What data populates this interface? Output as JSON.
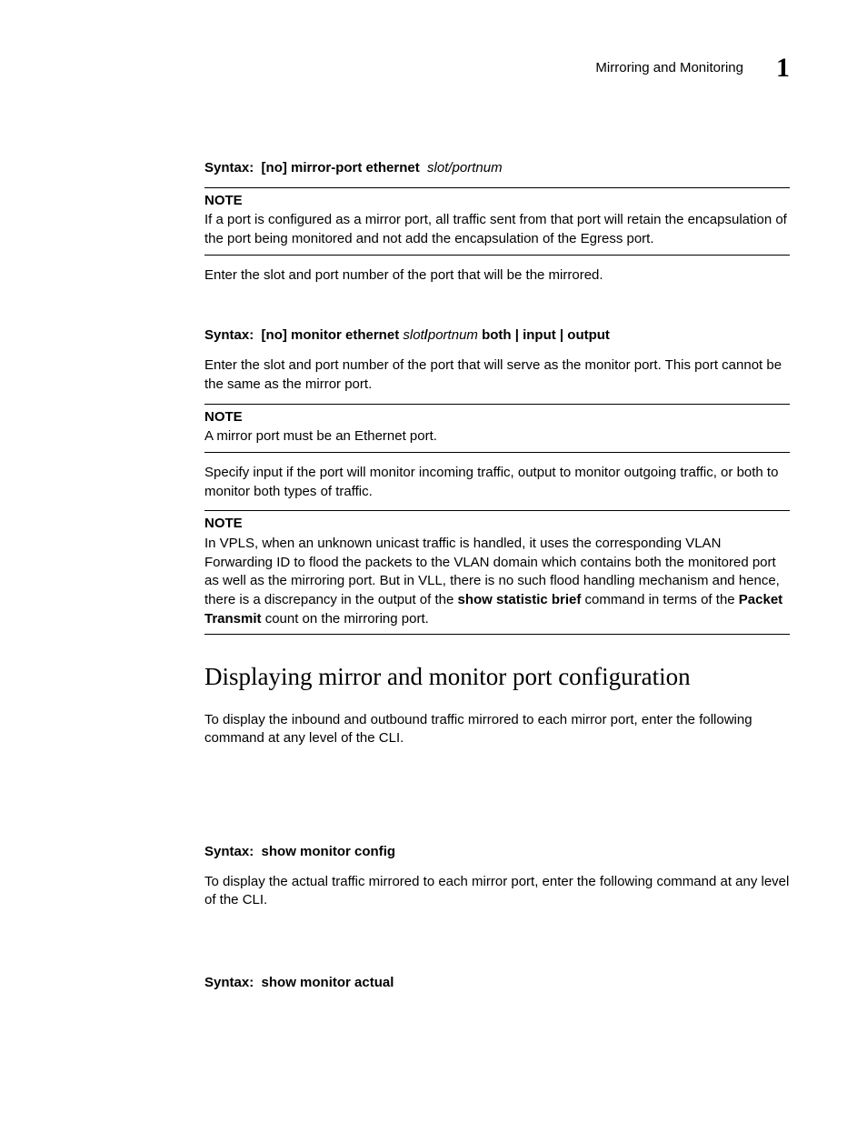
{
  "header": {
    "title": "Mirroring and Monitoring",
    "chapter": "1"
  },
  "syntax1": {
    "label": "Syntax:",
    "cmd": "[no] mirror-port ethernet",
    "var": "slot/portnum"
  },
  "note1": {
    "label": "NOTE",
    "body": "If a port is configured as a mirror port, all traffic sent from that port will retain the encapsulation of the port being monitored and not add the encapsulation of the Egress port."
  },
  "para1": "Enter the slot and port number of the port that will be the mirrored.",
  "syntax2": {
    "label": "Syntax:",
    "cmd": "[no] monitor ethernet",
    "var1": "slot",
    "sep": "/",
    "var2": "portnum",
    "tail": "both | input | output"
  },
  "para2": "Enter the slot and port number of the port that will serve as the monitor port. This port cannot be the same as the mirror port.",
  "note2": {
    "label": "NOTE",
    "body": "A mirror port must be an Ethernet port."
  },
  "para3": "Specify input if the port will monitor incoming traffic, output to monitor outgoing traffic, or both to monitor both types of traffic.",
  "note3": {
    "label": "NOTE",
    "body_pre": "In VPLS, when an unknown unicast traffic is handled, it uses the corresponding VLAN Forwarding ID to flood the packets to the VLAN domain which contains both the monitored port as well as the mirroring port. But in VLL, there is no such flood handling mechanism and hence, there is a discrepancy in the output of the ",
    "bold1": "show statistic brief",
    "mid": " command in terms of the ",
    "bold2": "Packet Transmit",
    "body_post": " count on the mirroring port."
  },
  "heading": "Displaying mirror and monitor port configuration",
  "para4": "To display the inbound and outbound traffic mirrored to each mirror port, enter the following command at any level of the CLI.",
  "syntax3": {
    "label": "Syntax:",
    "cmd": "show monitor config"
  },
  "para5": "To display the actual traffic mirrored to each mirror port, enter the following command at any level of the CLI.",
  "syntax4": {
    "label": "Syntax:",
    "cmd": "show monitor actual"
  }
}
